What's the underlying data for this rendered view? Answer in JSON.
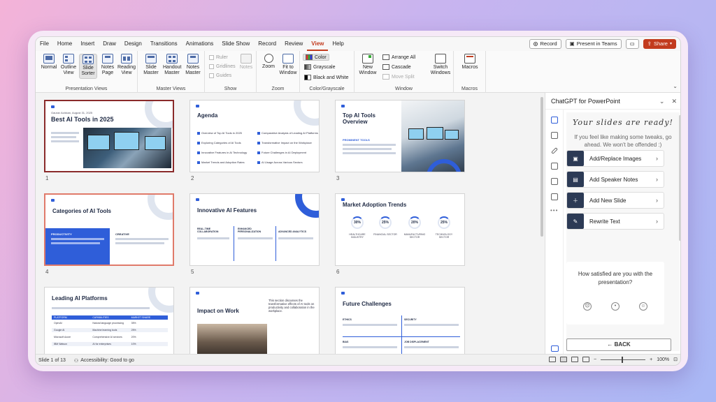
{
  "menu": {
    "items": [
      "File",
      "Home",
      "Insert",
      "Draw",
      "Design",
      "Transitions",
      "Animations",
      "Slide Show",
      "Record",
      "Review",
      "View",
      "Help"
    ],
    "active": "View",
    "record_label": "Record",
    "teams_label": "Present in Teams",
    "share_label": "Share"
  },
  "ribbon": {
    "presentation_views": {
      "label": "Presentation Views",
      "normal": "Normal",
      "outline_1": "Outline",
      "outline_2": "View",
      "slide_1": "Slide",
      "slide_2": "Sorter",
      "notes_1": "Notes",
      "notes_2": "Page",
      "reading_1": "Reading",
      "reading_2": "View"
    },
    "master_views": {
      "label": "Master Views",
      "slide_1": "Slide",
      "slide_2": "Master",
      "handout_1": "Handout",
      "handout_2": "Master",
      "notes_1": "Notes",
      "notes_2": "Master"
    },
    "show": {
      "label": "Show",
      "ruler": "Ruler",
      "gridlines": "Gridlines",
      "guides": "Guides",
      "notes": "Notes"
    },
    "zoom": {
      "label": "Zoom",
      "zoom": "Zoom",
      "fit_1": "Fit to",
      "fit_2": "Window"
    },
    "color": {
      "label": "Color/Grayscale",
      "color": "Color",
      "grayscale": "Grayscale",
      "bw": "Black and White"
    },
    "window": {
      "label": "Window",
      "new_1": "New",
      "new_2": "Window",
      "arrange": "Arrange All",
      "cascade": "Cascade",
      "move_split": "Move Split",
      "switch_1": "Switch",
      "switch_2": "Windows"
    },
    "macros": {
      "label": "Macros",
      "macros": "Macros"
    }
  },
  "slides": [
    {
      "num": "1",
      "title": "Best AI Tools in 2025",
      "author": "Gaurav Acikkan, August 31, 2025"
    },
    {
      "num": "2",
      "title": "Agenda",
      "items": [
        "Overview of Top AI Tools in 2025",
        "Exploring Categories of AI Tools",
        "Innovative Features in AI Technology",
        "Market Trends and Adoption Rates",
        "Comparative Analysis of Leading AI Platforms",
        "Transformative Impact on the Workplace",
        "Future Challenges in AI Deployment",
        "AI Usage Across Various Sectors"
      ]
    },
    {
      "num": "3",
      "title": "Top AI Tools Overview",
      "sub": "PROMINENT TOOLS"
    },
    {
      "num": "4",
      "title": "Categories of AI Tools",
      "left": "PRODUCTIVITY",
      "right": "CREATIVE"
    },
    {
      "num": "5",
      "title": "Innovative AI Features",
      "c1": "REAL-TIME COLLABORATION",
      "c2": "ENHANCED PERSONALIZATION",
      "c3": "ADVANCED ANALYTICS"
    },
    {
      "num": "6",
      "title": "Market Adoption Trends",
      "rings": [
        "30%",
        "25%",
        "20%",
        "25%"
      ],
      "caps": [
        "HEALTHCARE INDUSTRY",
        "FINANCIAL SECTOR",
        "MANUFACTURING SECTOR",
        "TECHNOLOGY SECTOR"
      ]
    },
    {
      "num": "7",
      "title": "Leading AI Platforms",
      "cols": [
        "PLATFORM",
        "CAPABILITIES",
        "MARKET SHARE"
      ],
      "rows": [
        [
          "OpenAI",
          "Natural language processing",
          "35%"
        ],
        [
          "Google AI",
          "Machine learning tools",
          "25%"
        ],
        [
          "Microsoft Azure",
          "Comprehensive AI services",
          "20%"
        ],
        [
          "IBM Watson",
          "AI for enterprises",
          "10%"
        ]
      ]
    },
    {
      "num": "8",
      "title": "Impact on Work",
      "body": "This section discusses the transformative effects of AI tools on productivity and collaboration in the workplace."
    },
    {
      "num": "9",
      "title": "Future Challenges",
      "q1": "ETHICS",
      "q2": "SECURITY",
      "q3": "BIAS",
      "q4": "JOB DISPLACEMENT"
    }
  ],
  "status": {
    "slide": "Slide 1 of 13",
    "accessibility": "Accessibility: Good to go",
    "zoom": "100%"
  },
  "pane": {
    "title": "ChatGPT for PowerPoint",
    "heading": "Your slides are ready!",
    "subtitle": "If you feel like making some tweaks, go ahead. We won't be offended :)",
    "actions": [
      "Add/Replace Images",
      "Add Speaker Notes",
      "Add New Slide",
      "Rewrite Text"
    ],
    "survey_q": "How satisfied are you with the presentation?",
    "back": "BACK"
  },
  "colors": {
    "accent": "#c23b1e",
    "brand_blue": "#2f5ed9",
    "navy": "#2c3a55"
  }
}
